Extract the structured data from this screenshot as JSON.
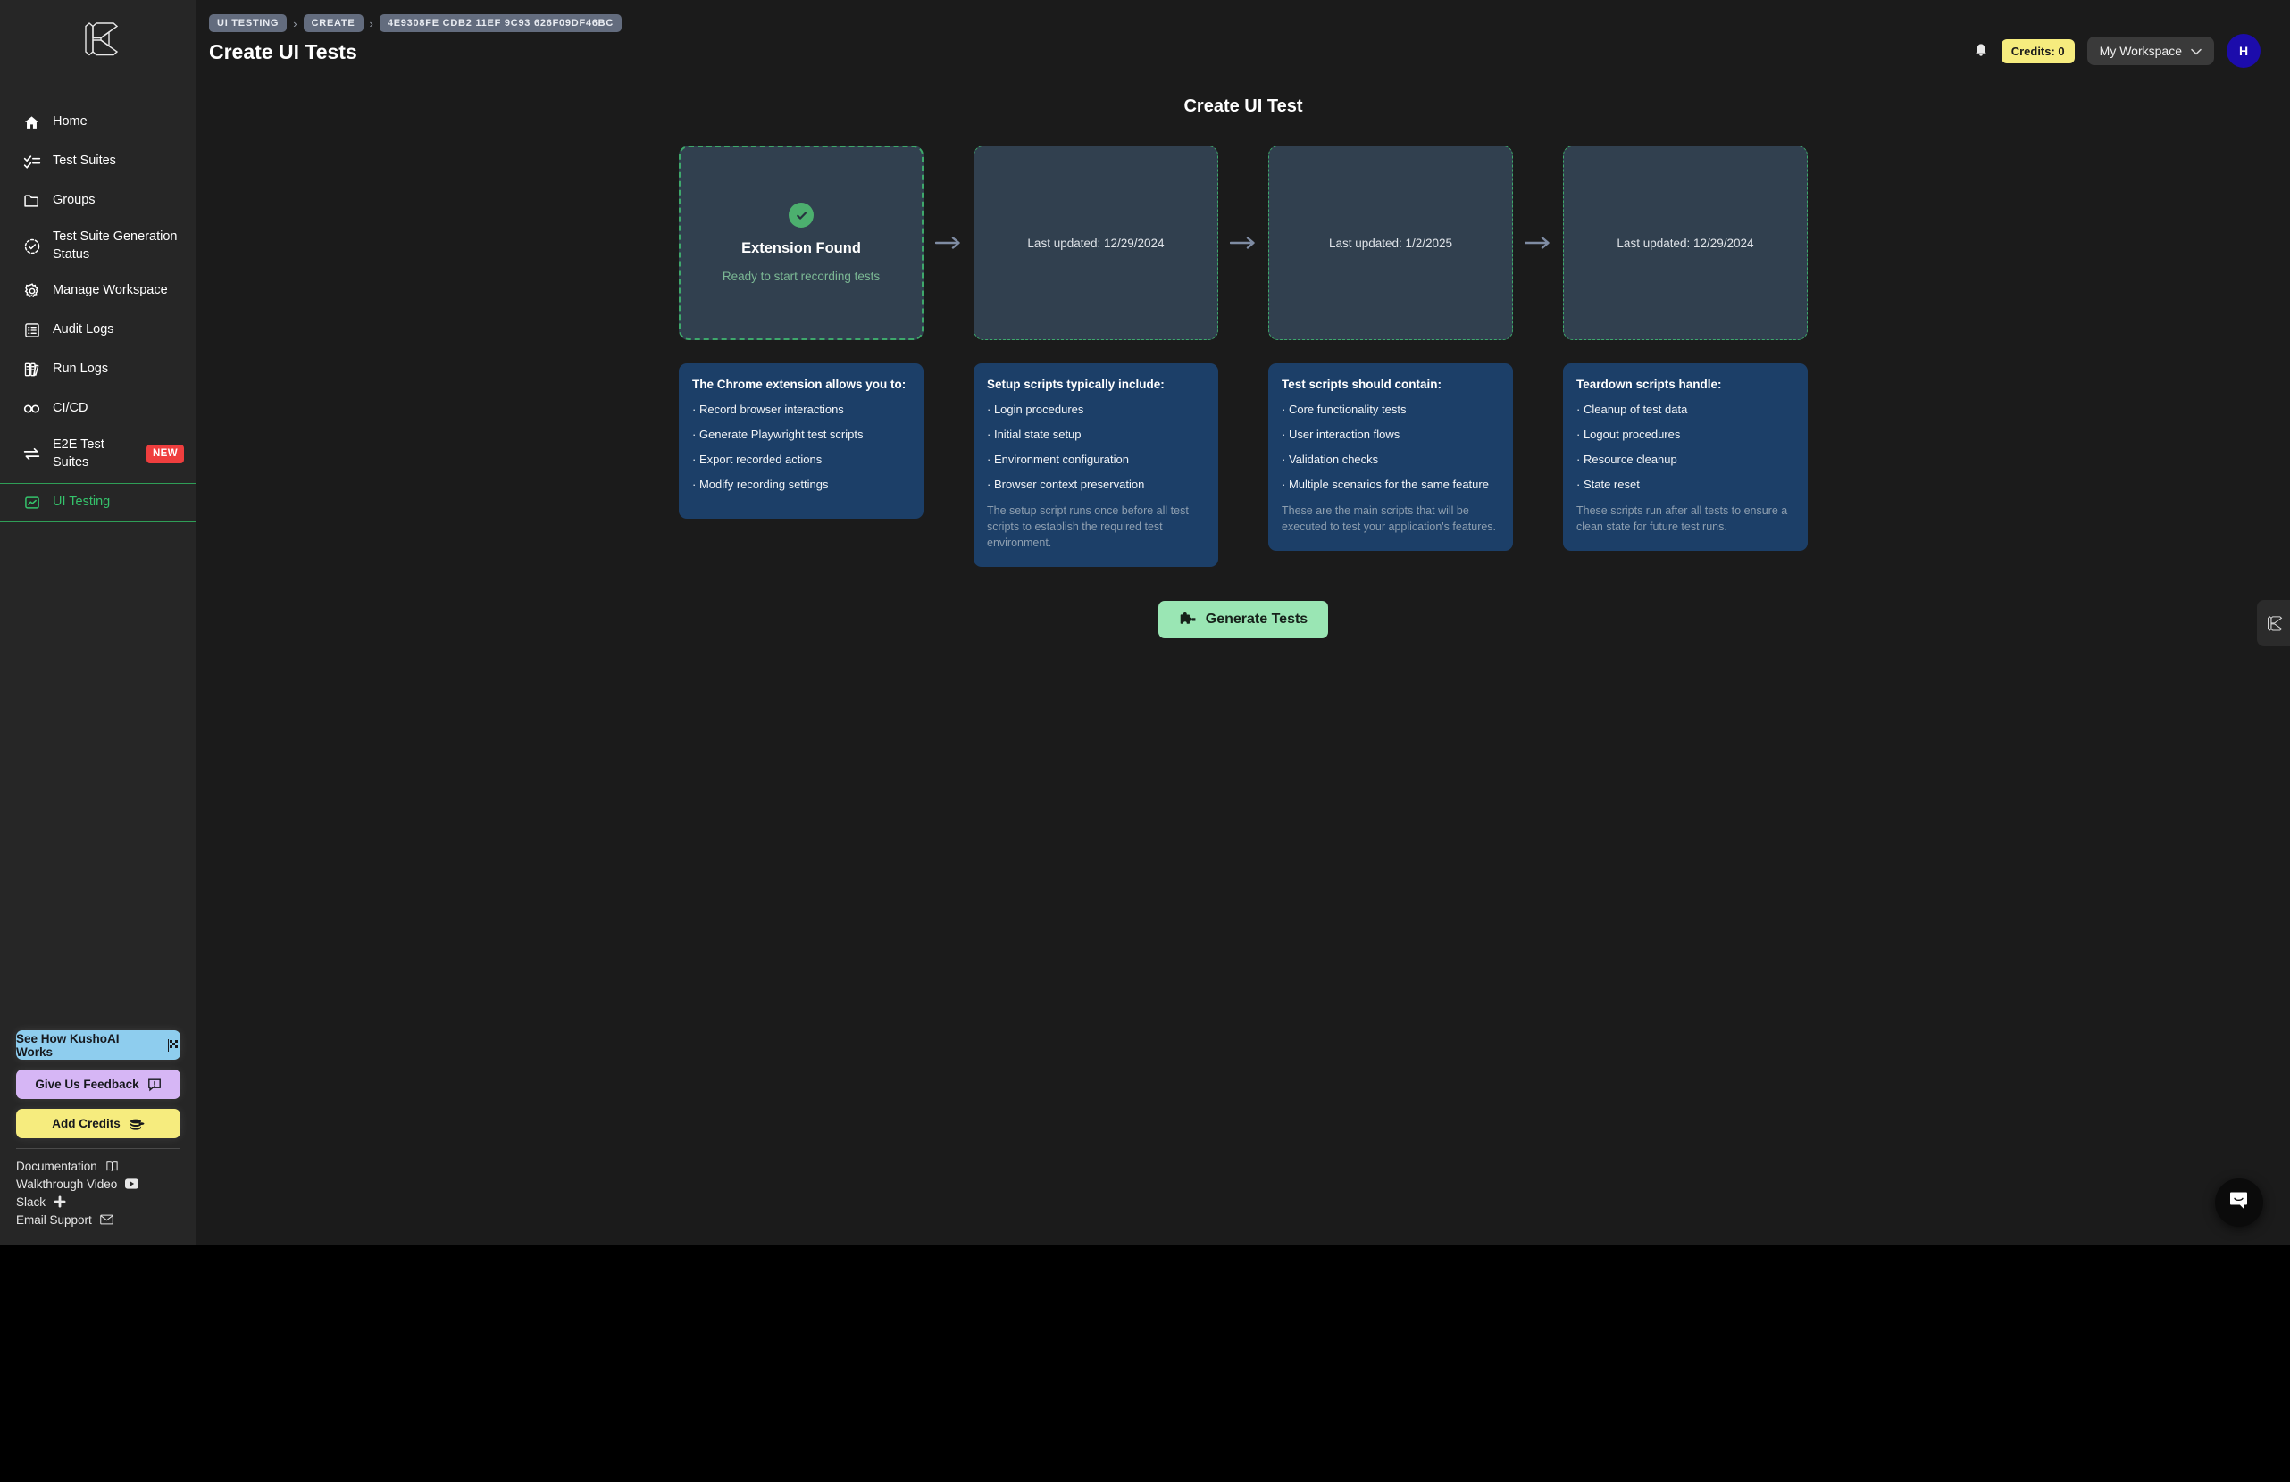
{
  "app": {
    "logo_icon": "kusho-logo-icon"
  },
  "sidebar": {
    "items": [
      {
        "label": "Home",
        "icon": "home-icon",
        "active": false
      },
      {
        "label": "Test Suites",
        "icon": "checklist-icon",
        "active": false
      },
      {
        "label": "Groups",
        "icon": "folder-icon",
        "active": false
      },
      {
        "label": "Test Suite Generation Status",
        "icon": "clock-check-icon",
        "active": false
      },
      {
        "label": "Manage Workspace",
        "icon": "gear-icon",
        "active": false
      },
      {
        "label": "Audit Logs",
        "icon": "list-icon",
        "active": false
      },
      {
        "label": "Run Logs",
        "icon": "books-icon",
        "active": false
      },
      {
        "label": "CI/CD",
        "icon": "infinity-icon",
        "active": false
      },
      {
        "label": "E2E Test Suites",
        "icon": "arrows-swap-icon",
        "badge": "NEW",
        "active": false
      },
      {
        "label": "UI Testing",
        "icon": "chart-box-icon",
        "active": true
      }
    ],
    "ctas": [
      {
        "label": "See How KushoAI Works",
        "icon": "checkered-flag-icon",
        "color": "#8ecdee"
      },
      {
        "label": "Give Us Feedback",
        "icon": "feedback-icon",
        "color": "#d6b6f5"
      },
      {
        "label": "Add Credits",
        "icon": "coins-icon",
        "color": "#f6ec7e"
      }
    ],
    "links": [
      {
        "label": "Documentation",
        "icon": "book-icon"
      },
      {
        "label": "Walkthrough Video",
        "icon": "youtube-icon"
      },
      {
        "label": "Slack",
        "icon": "slack-icon"
      },
      {
        "label": "Email Support",
        "icon": "envelope-icon"
      }
    ]
  },
  "header": {
    "breadcrumbs": [
      "UI TESTING",
      "CREATE",
      "4E9308FE CDB2 11EF 9C93 626F09DF46BC"
    ],
    "separator": "›",
    "page_title": "Create UI Tests",
    "bell_icon": "bell-icon",
    "credits_label": "Credits: 0",
    "workspace_label": "My Workspace",
    "workspace_chevron": "chevron-down-icon",
    "avatar_initial": "H"
  },
  "main": {
    "section_title": "Create UI Test",
    "arrow_icon": "arrow-right-icon",
    "columns": [
      {
        "drop": {
          "kind": "extension",
          "status_icon": "check-circle-icon",
          "title": "Extension Found",
          "subtitle": "Ready to start recording tests"
        },
        "info": {
          "heading": "The Chrome extension allows you to:",
          "bullets": [
            "Record browser interactions",
            "Generate Playwright test scripts",
            "Export recorded actions",
            "Modify recording settings"
          ],
          "note": ""
        }
      },
      {
        "drop": {
          "kind": "date",
          "date_label": "Last updated: 12/29/2024"
        },
        "info": {
          "heading": "Setup scripts typically include:",
          "bullets": [
            "Login procedures",
            "Initial state setup",
            "Environment configuration",
            "Browser context preservation"
          ],
          "note": "The setup script runs once before all test scripts to establish the required test environment."
        }
      },
      {
        "drop": {
          "kind": "date",
          "date_label": "Last updated: 1/2/2025"
        },
        "info": {
          "heading": "Test scripts should contain:",
          "bullets": [
            "Core functionality tests",
            "User interaction flows",
            "Validation checks",
            "Multiple scenarios for the same feature"
          ],
          "note": "These are the main scripts that will be executed to test your application's features."
        }
      },
      {
        "drop": {
          "kind": "date",
          "date_label": "Last updated: 12/29/2024"
        },
        "info": {
          "heading": "Teardown scripts handle:",
          "bullets": [
            "Cleanup of test data",
            "Logout procedures",
            "Resource cleanup",
            "State reset"
          ],
          "note": "These scripts run after all tests to ensure a clean state for future test runs."
        }
      }
    ],
    "generate_button": {
      "label": "Generate Tests",
      "icon": "puzzle-piece-icon"
    },
    "side_tab_icon": "kusho-logo-icon",
    "intercom_icon": "chat-bubble-icon"
  },
  "colors": {
    "accent_green": "#35c26b",
    "dashed_border": "#3ea86b",
    "info_card_bg": "#1c3f68",
    "drop_card_bg": "#31404f",
    "generate_bg": "#9ae6b4",
    "badge_red": "#ef3e3e",
    "credits_yellow": "#f6ec7e",
    "avatar_bg": "#1c0cab"
  }
}
